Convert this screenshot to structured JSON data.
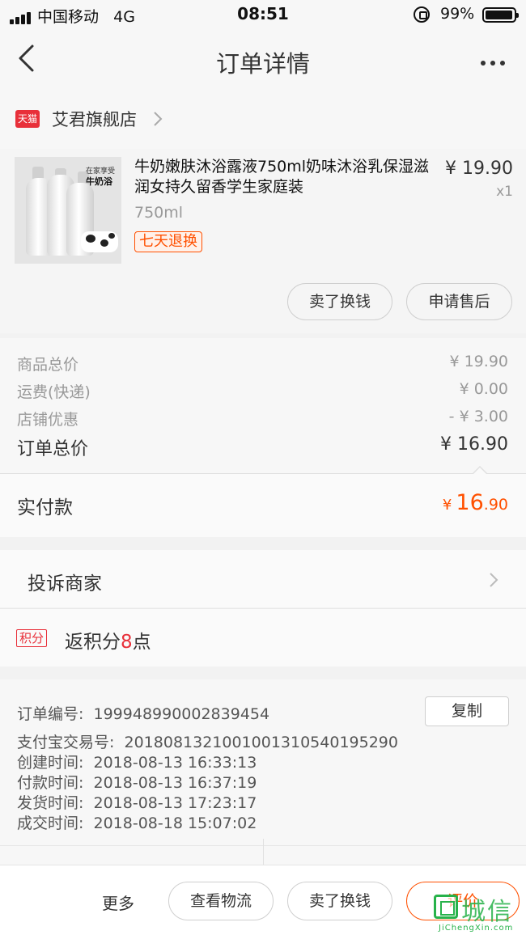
{
  "status_bar": {
    "carrier": "中国移动",
    "network": "4G",
    "time": "08:51",
    "battery": "99%"
  },
  "nav": {
    "title": "订单详情",
    "back_icon": "chevron-left-icon",
    "more_icon": "more-dots-icon"
  },
  "shop": {
    "platform_badge": "天猫",
    "name": "艾君旗舰店"
  },
  "product": {
    "title": "牛奶嫩肤沐浴露液750ml奶味沐浴乳保湿滋润女持久留香学生家庭装",
    "spec": "750ml",
    "badge": "七天退换",
    "price": "¥ 19.90",
    "qty": "x1",
    "image_tag1": "在家享受",
    "image_tag2": "牛奶浴",
    "buttons": {
      "sell": "卖了换钱",
      "after_sale": "申请售后"
    }
  },
  "summary": {
    "rows": [
      {
        "label": "商品总价",
        "value": "¥ 19.90"
      },
      {
        "label": "运费(快递)",
        "value": "¥ 0.00"
      },
      {
        "label": "店铺优惠",
        "value": "- ¥ 3.00"
      }
    ],
    "total_label": "订单总价",
    "total_value": "¥ 16.90",
    "paid_label": "实付款",
    "paid_currency": "¥",
    "paid_int": "16",
    "paid_dec": ".90"
  },
  "complain": {
    "label": "投诉商家"
  },
  "points": {
    "badge": "积分",
    "prefix": "返积分",
    "num": "8",
    "suffix": "点"
  },
  "order_info": {
    "copy_label": "复制",
    "rows": [
      {
        "label": "订单编号:",
        "value": "199948990002839454"
      },
      {
        "label": "支付宝交易号:",
        "value": "2018081321001001310540195290"
      },
      {
        "label": "创建时间:",
        "value": "2018-08-13 16:33:13"
      },
      {
        "label": "付款时间:",
        "value": "2018-08-13 16:37:19"
      },
      {
        "label": "发货时间:",
        "value": "2018-08-13 17:23:17"
      },
      {
        "label": "成交时间:",
        "value": "2018-08-18 15:07:02"
      }
    ]
  },
  "bottom_bar": {
    "more": "更多",
    "logistics": "查看物流",
    "sell": "卖了换钱",
    "review": "评价"
  },
  "watermark": {
    "cn": "城信",
    "en": "JiChengXin.com"
  },
  "colors": {
    "accent": "#ff5000",
    "tmall_red": "#e8303a",
    "watermark_green": "#27b24a"
  }
}
